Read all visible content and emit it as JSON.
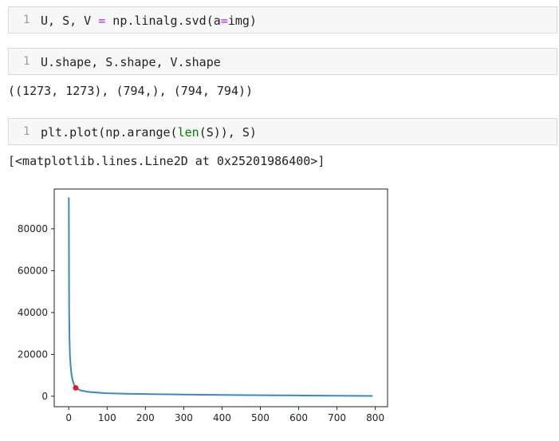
{
  "cells": [
    {
      "line_number": "1",
      "code_parts": [
        "U, S, V ",
        "=",
        " np.linalg.svd(a",
        "=",
        "img)"
      ]
    },
    {
      "line_number": "1",
      "code_parts": [
        "U.shape, S.shape, V.shape"
      ],
      "output": "((1273, 1273), (794,), (794, 794))"
    },
    {
      "line_number": "1",
      "code_parts": [
        "plt.plot(np.arange(",
        "len",
        "(S)), S)"
      ],
      "output": "[<matplotlib.lines.Line2D at 0x25201986400>]"
    }
  ],
  "colors": {
    "line": "#3d85c6",
    "marker": "#e02020"
  },
  "chart_data": {
    "type": "line",
    "title": "",
    "xlabel": "",
    "ylabel": "",
    "xlim": [
      -38,
      832
    ],
    "ylim": [
      -5000,
      99000
    ],
    "xticks": [
      0,
      100,
      200,
      300,
      400,
      500,
      600,
      700,
      800
    ],
    "yticks": [
      0,
      20000,
      40000,
      60000,
      80000
    ],
    "grid": false,
    "series": [
      {
        "x": [
          0,
          1,
          2,
          3,
          5,
          7,
          10,
          15,
          20,
          30,
          50,
          80,
          100,
          150,
          200,
          300,
          400,
          500,
          600,
          700,
          793
        ],
        "y": [
          95000,
          40000,
          27000,
          19500,
          14000,
          10500,
          7500,
          5000,
          3800,
          2800,
          2100,
          1650,
          1450,
          1200,
          1050,
          800,
          620,
          480,
          360,
          250,
          150
        ]
      }
    ],
    "highlight_point": {
      "x": 18,
      "y": 4000
    }
  }
}
